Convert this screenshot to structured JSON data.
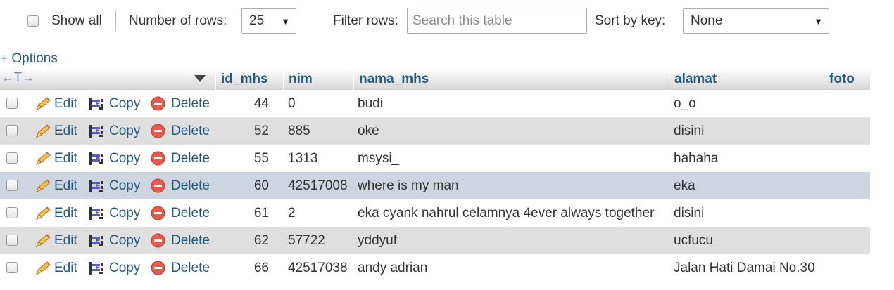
{
  "toolbar": {
    "show_all_label": "Show all",
    "num_rows_label": "Number of rows:",
    "num_rows_value": "25",
    "filter_label": "Filter rows:",
    "search_placeholder": "Search this table",
    "sort_label": "Sort by key:",
    "sort_value": "None"
  },
  "options_label": "+ Options",
  "table": {
    "header_arrows": "←T→",
    "columns": [
      "id_mhs",
      "nim",
      "nama_mhs",
      "alamat",
      "foto"
    ],
    "actions": {
      "edit": "Edit",
      "copy": "Copy",
      "delete": "Delete"
    },
    "rows": [
      {
        "id_mhs": "44",
        "nim": "0",
        "nama_mhs": "budi",
        "alamat": "o_o",
        "foto": ""
      },
      {
        "id_mhs": "52",
        "nim": "885",
        "nama_mhs": "oke",
        "alamat": "disini",
        "foto": ""
      },
      {
        "id_mhs": "55",
        "nim": "1313",
        "nama_mhs": "msysi_",
        "alamat": "hahaha",
        "foto": ""
      },
      {
        "id_mhs": "60",
        "nim": "42517008",
        "nama_mhs": "where is my man",
        "alamat": "eka",
        "foto": ""
      },
      {
        "id_mhs": "61",
        "nim": "2",
        "nama_mhs": "eka cyank nahrul celamnya 4ever always together",
        "alamat": "disini",
        "foto": ""
      },
      {
        "id_mhs": "62",
        "nim": "57722",
        "nama_mhs": "yddyuf",
        "alamat": "ucfucu",
        "foto": ""
      },
      {
        "id_mhs": "66",
        "nim": "42517038",
        "nama_mhs": "andy adrian",
        "alamat": "Jalan Hati Damai No.30",
        "foto": ""
      }
    ]
  },
  "colors": {
    "link": "#235a81",
    "row_even": "#dfdfdf",
    "row_highlight": "#cdd6e0"
  },
  "icons": {
    "edit": "pencil-icon",
    "copy": "copy-icon",
    "delete": "delete-icon"
  }
}
